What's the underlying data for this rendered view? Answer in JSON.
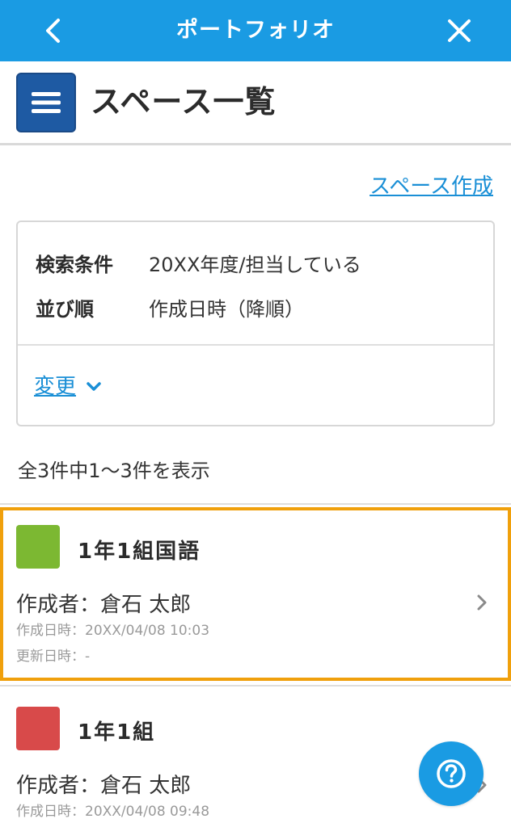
{
  "header": {
    "title": "ポートフォリオ",
    "back_icon": "chevron-left-icon",
    "close_icon": "close-icon",
    "bg_color": "#1a9be3"
  },
  "page": {
    "title": "スペース一覧",
    "menu_icon": "hamburger-menu-icon",
    "create_link": "スペース作成"
  },
  "conditions": {
    "search_label": "検索条件",
    "search_value": "20XX年度/担当している",
    "sort_label": "並び順",
    "sort_value": "作成日時（降順）",
    "change_label": "変更"
  },
  "summary": {
    "count_text": "全3件中1〜3件を表示"
  },
  "spaces": [
    {
      "name": "1年1組国語",
      "color": "#7cb832",
      "creator": "作成者：倉石 太郎",
      "created": "作成日時：20XX/04/08 10:03",
      "updated": "更新日時：-",
      "selected": true
    },
    {
      "name": "1年1組",
      "color": "#d84a4a",
      "creator": "作成者：倉石 太郎",
      "created": "作成日時：20XX/04/08 09:48"
    }
  ],
  "help": {
    "icon": "help-question-icon"
  }
}
